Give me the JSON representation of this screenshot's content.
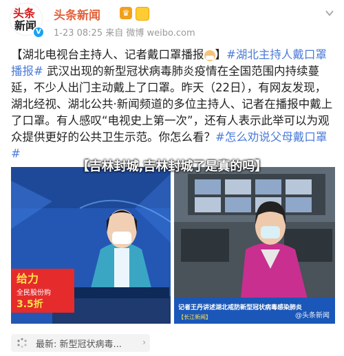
{
  "header": {
    "avatar_line1": "头条",
    "avatar_line2": "新闻",
    "name": "头条新闻",
    "meta": "1-23 08:25  来自 微博 weibo.com"
  },
  "post": {
    "p1": "【湖北电视台主持人、记者戴口罩播报",
    "p1b": "】",
    "tag1": "#湖北主持人戴口罩播报#",
    "p2": " 武汉出现的新型冠状病毒肺炎疫情在全国范围内持续蔓延，不少人出门主动戴上了口罩。昨天（22日），有网友发现，湖北经视、湖北公共·新闻频道的多位主持人、记者在播报中戴上了口罩。有人感叹“电视史上第一次”，还有人表示此举可以为观众提供更好的公共卫生示范。你怎么看？",
    "tag2": "#怎么劝说父母戴口罩#"
  },
  "overlay_title": "【吉林封城,吉林封城了是真的吗】",
  "left_photo": {
    "promo_line1": "给力",
    "promo_line2": "全民股份购",
    "promo_line3": "3.5折"
  },
  "right_photo": {
    "ticker": "记者王丹讲述湖北戒防新型冠状病毒感染肺炎",
    "ticker_sub": "【长江新闻】"
  },
  "watermark": "@头条新闻",
  "bottom_bar": {
    "text": "最新: 新型冠状病毒..."
  },
  "colors": {
    "brand": "#e3613a",
    "link": "#4b7bd8"
  }
}
